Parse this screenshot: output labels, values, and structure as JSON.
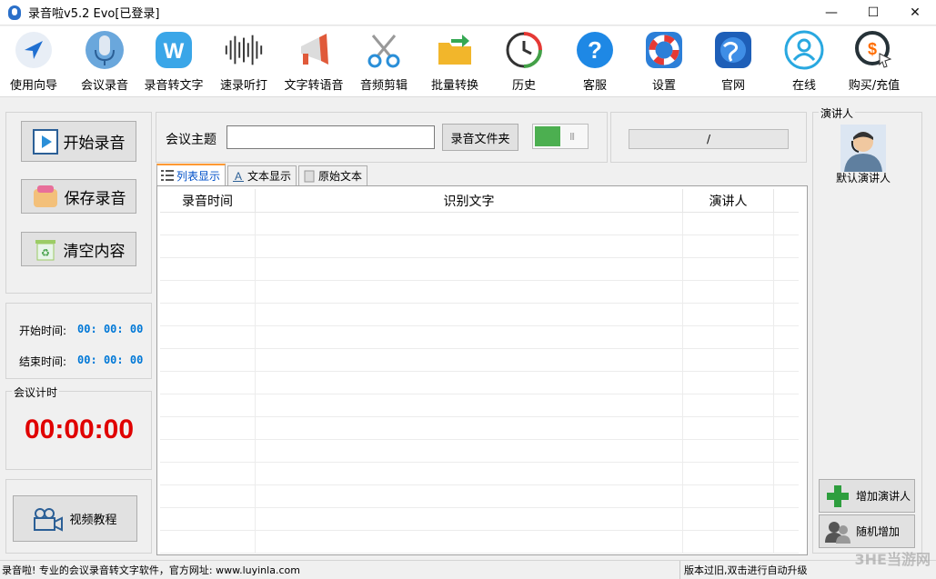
{
  "window": {
    "title": "录音啦v5.2 Evo[已登录]",
    "controls": [
      "—",
      "☐",
      "✕"
    ]
  },
  "toolbar": {
    "items": [
      {
        "label": "使用向导",
        "icon": "navigation-arrow-icon"
      },
      {
        "label": "会议录音",
        "icon": "microphone-icon"
      },
      {
        "label": "录音转文字",
        "icon": "w-letter-icon"
      },
      {
        "label": "速录听打",
        "icon": "sound-wave-icon"
      },
      {
        "label": "文字转语音",
        "icon": "megaphone-icon"
      },
      {
        "label": "音频剪辑",
        "icon": "scissors-icon"
      },
      {
        "label": "批量转换",
        "icon": "folder-arrow-icon"
      },
      {
        "label": "历史",
        "icon": "clock-history-icon"
      },
      {
        "label": "客服",
        "icon": "question-icon"
      },
      {
        "label": "设置",
        "icon": "lifebuoy-icon"
      },
      {
        "label": "官网",
        "icon": "globe-icon"
      },
      {
        "label": "在线",
        "icon": "user-online-icon"
      },
      {
        "label": "购买/充值",
        "icon": "dollar-cursor-icon"
      }
    ]
  },
  "left": {
    "start_label": "开始录音",
    "save_label": "保存录音",
    "clear_label": "清空内容",
    "start_time_label": "开始时间:",
    "start_time_value": "00: 00: 00",
    "end_time_label": "结束时间:",
    "end_time_value": "00: 00: 00",
    "timer_group": "会议计时",
    "timer_value": "00:00:00",
    "video_label": "视频教程"
  },
  "center": {
    "topic_label": "会议主题",
    "topic_value": "",
    "folder_label": "录音文件夹",
    "toggle_on": true,
    "progress_text": "/",
    "tabs": [
      "列表显示",
      "文本显示",
      "原始文本"
    ],
    "active_tab": 0,
    "columns": [
      "录音时间",
      "识别文字",
      "演讲人",
      ""
    ]
  },
  "right": {
    "group_title": "演讲人",
    "default_speaker": "默认演讲人",
    "add_label": "增加演讲人",
    "random_label": "随机增加"
  },
  "status": {
    "left_text": "录音啦! 专业的会议录音转文字软件，官方网址: www.luyinla.com",
    "right_text": "版本过旧,双击进行自动升级",
    "watermark": "3HE当游网"
  },
  "colors": {
    "accent": "#0078d7",
    "timer": "#e00000",
    "toggle": "#4caf50"
  }
}
